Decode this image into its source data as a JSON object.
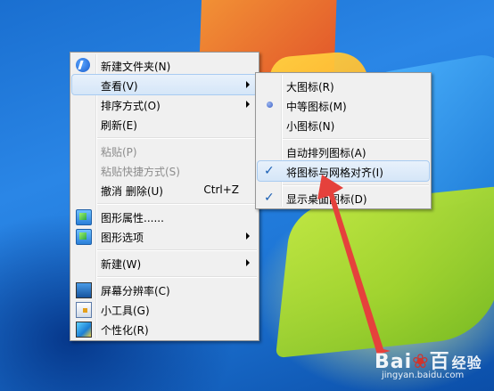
{
  "context_menu": {
    "items": [
      {
        "label": "新建文件夹(N)",
        "icon": "new-folder-icon"
      },
      {
        "label": "查看(V)",
        "submenu": true
      },
      {
        "label": "排序方式(O)",
        "submenu": true
      },
      {
        "label": "刷新(E)"
      },
      {
        "label": "粘贴(P)",
        "disabled": true
      },
      {
        "label": "粘贴快捷方式(S)",
        "disabled": true
      },
      {
        "label": "撤消 删除(U)",
        "shortcut": "Ctrl+Z"
      },
      {
        "label": "图形属性......",
        "icon": "graphics-properties-icon"
      },
      {
        "label": "图形选项",
        "icon": "graphics-options-icon",
        "submenu": true
      },
      {
        "label": "新建(W)",
        "submenu": true
      },
      {
        "label": "屏幕分辨率(C)",
        "icon": "screen-resolution-icon"
      },
      {
        "label": "小工具(G)",
        "icon": "gadgets-icon"
      },
      {
        "label": "个性化(R)",
        "icon": "personalize-icon"
      }
    ]
  },
  "view_submenu": {
    "items": [
      {
        "label": "大图标(R)"
      },
      {
        "label": "中等图标(M)",
        "selected": true
      },
      {
        "label": "小图标(N)"
      },
      {
        "label": "自动排列图标(A)"
      },
      {
        "label": "将图标与网格对齐(I)",
        "checked": true
      },
      {
        "label": "显示桌面图标(D)",
        "checked": true
      }
    ]
  },
  "annotation": {
    "arrow_color": "#e5413c"
  },
  "watermark": {
    "logo_left": "Bai",
    "logo_right": "百",
    "suffix": "经验",
    "url": "jingyan.baidu.com"
  }
}
